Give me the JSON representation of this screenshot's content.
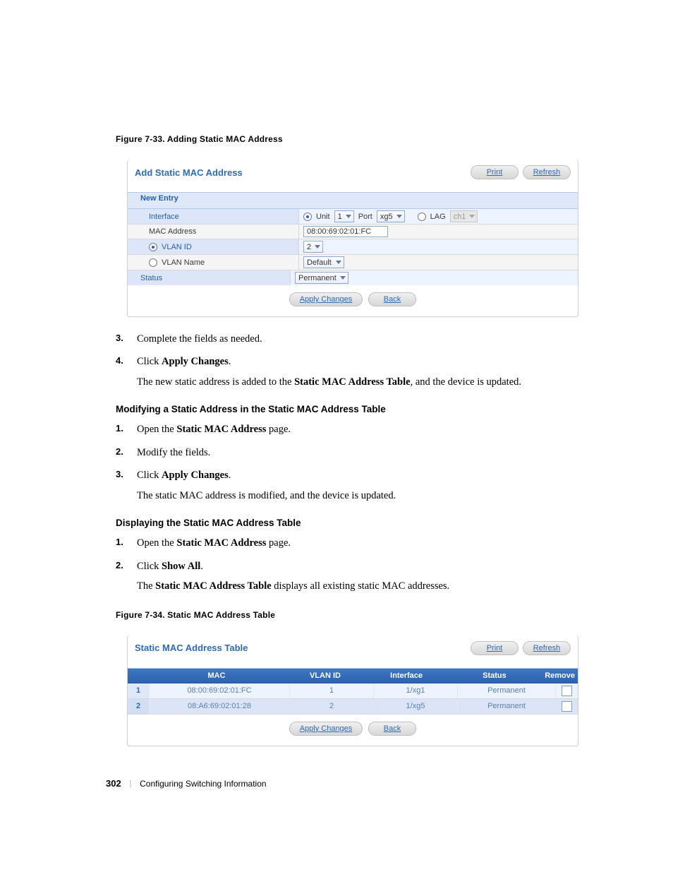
{
  "figure_a": {
    "caption": "Figure 7-33.    Adding Static MAC Address",
    "title": "Add Static MAC Address",
    "buttons": {
      "print": "Print",
      "refresh": "Refresh"
    },
    "section": "New Entry",
    "rows": {
      "interface_label": "Interface",
      "interface": {
        "unit_label": "Unit",
        "unit_value": "1",
        "port_label": "Port",
        "port_value": "xg5",
        "lag_label": "LAG",
        "lag_value": "ch1"
      },
      "mac_label": "MAC Address",
      "mac_value": "08:00:69:02:01:FC",
      "vlan_id_label": "VLAN ID",
      "vlan_id_value": "2",
      "vlan_name_label": "VLAN Name",
      "vlan_name_value": "Default",
      "status_label": "Status",
      "status_value": "Permanent"
    },
    "footer": {
      "apply": "Apply Changes",
      "back": "Back"
    }
  },
  "steps_a": [
    {
      "n": "3.",
      "text": "Complete the fields as needed."
    },
    {
      "n": "4.",
      "text_pre": "Click ",
      "text_b": "Apply Changes",
      "text_post": ".",
      "follow_pre": "The new static address is added to the ",
      "follow_b": "Static MAC Address Table",
      "follow_post": ", and the device is updated."
    }
  ],
  "heading_b": "Modifying a Static Address in the Static MAC Address Table",
  "steps_b": [
    {
      "n": "1.",
      "text_pre": "Open the ",
      "text_b": "Static MAC Address",
      "text_post": " page."
    },
    {
      "n": "2.",
      "text": "Modify the fields."
    },
    {
      "n": "3.",
      "text_pre": "Click ",
      "text_b": "Apply Changes",
      "text_post": ".",
      "follow": "The static MAC address is modified, and the device is updated."
    }
  ],
  "heading_c": "Displaying the Static MAC Address Table",
  "steps_c": [
    {
      "n": "1.",
      "text_pre": "Open the ",
      "text_b": "Static MAC Address",
      "text_post": " page."
    },
    {
      "n": "2.",
      "text_pre": "Click ",
      "text_b": "Show All",
      "text_post": ".",
      "follow_pre": "The ",
      "follow_b": "Static MAC Address Table",
      "follow_post": " displays all existing static MAC addresses."
    }
  ],
  "figure_b": {
    "caption": "Figure 7-34.    Static MAC Address Table",
    "title": "Static MAC Address Table",
    "buttons": {
      "print": "Print",
      "refresh": "Refresh"
    },
    "headers": {
      "mac": "MAC",
      "vlan": "VLAN ID",
      "iface": "Interface",
      "status": "Status",
      "remove": "Remove"
    },
    "rows": [
      {
        "idx": "1",
        "mac": "08:00:69:02:01:FC",
        "vlan": "1",
        "iface": "1/xg1",
        "status": "Permanent"
      },
      {
        "idx": "2",
        "mac": "08:A6:69:02:01:28",
        "vlan": "2",
        "iface": "1/xg5",
        "status": "Permanent"
      }
    ],
    "footer": {
      "apply": "Apply Changes",
      "back": "Back"
    }
  },
  "footer": {
    "page": "302",
    "section": "Configuring Switching Information"
  }
}
